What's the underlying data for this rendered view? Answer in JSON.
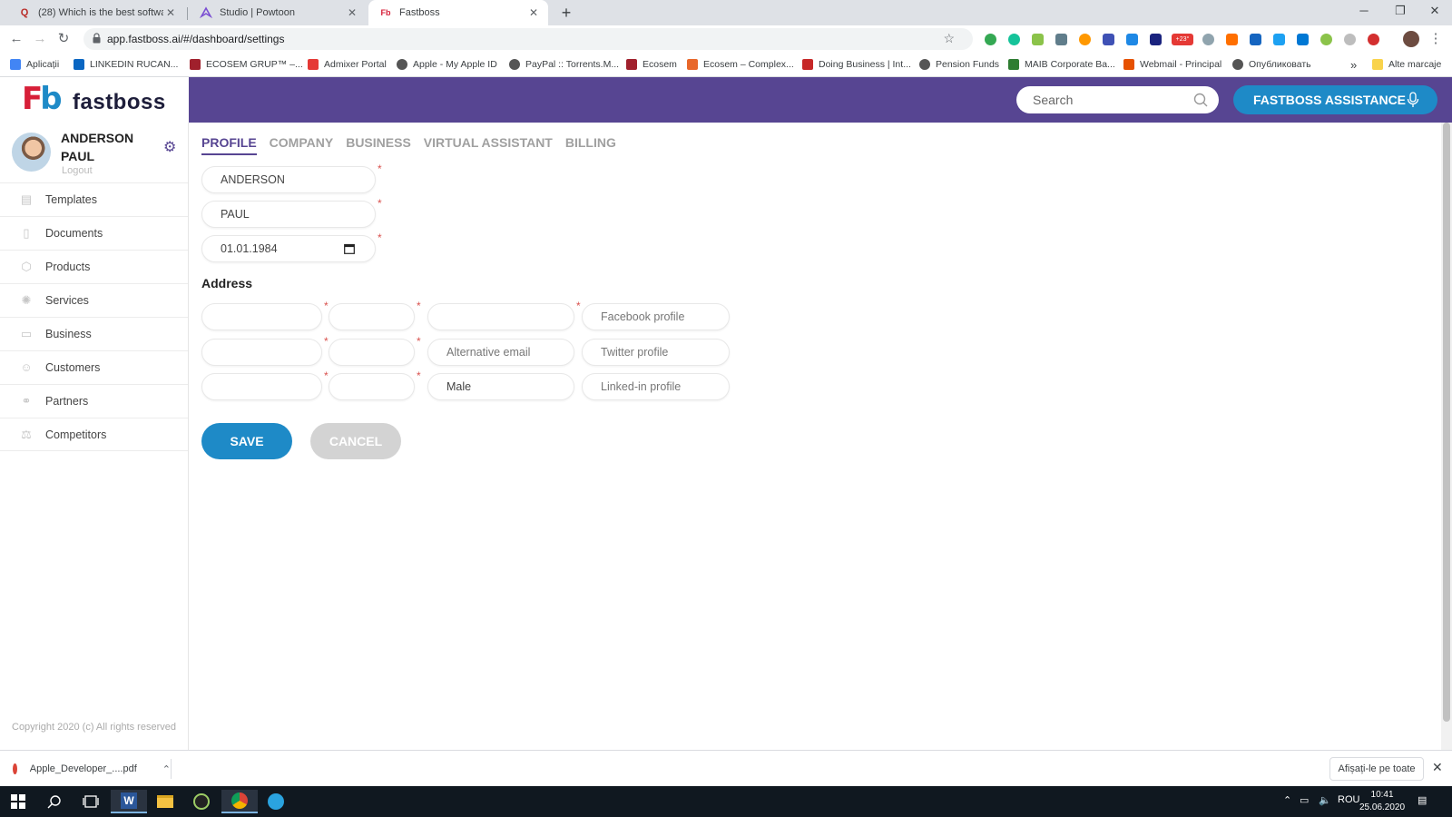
{
  "browser": {
    "tabs": [
      {
        "label": "(28) Which is the best software to",
        "favicon": "Q",
        "favicon_color": "#b92b27",
        "active": false
      },
      {
        "label": "Studio | Powtoon",
        "favicon": "powtoon-icon",
        "favicon_color": "#7b4fd3",
        "active": false
      },
      {
        "label": "Fastboss",
        "favicon": "fastboss-icon",
        "favicon_color": "#d71f38",
        "active": true
      }
    ],
    "url": "app.fastboss.ai/#/dashboard/settings",
    "bookmarks": [
      {
        "label": "Aplicații",
        "color": "#4285f4"
      },
      {
        "label": "LINKEDIN RUCAN...",
        "color": "#0a66c2"
      },
      {
        "label": "ECOSEM GRUP™ –...",
        "color": "#a0202c"
      },
      {
        "label": "Admixer Portal",
        "color": "#e53935"
      },
      {
        "label": "Apple - My Apple ID",
        "color": "#555555"
      },
      {
        "label": "PayPal :: Torrents.M...",
        "color": "#555555"
      },
      {
        "label": "Ecosem",
        "color": "#a0202c"
      },
      {
        "label": "Ecosem – Complex...",
        "color": "#e8672a"
      },
      {
        "label": "Doing Business | Int...",
        "color": "#c62828"
      },
      {
        "label": "Pension Funds",
        "color": "#555555"
      },
      {
        "label": "MAIB Corporate Ba...",
        "color": "#2e7d32"
      },
      {
        "label": "Webmail - Principal",
        "color": "#e65100"
      },
      {
        "label": "Опубликовать",
        "color": "#555555"
      }
    ],
    "bookmarks_more": "»",
    "other_bookmarks": "Alte marcaje",
    "extension_badge": "+23°"
  },
  "app": {
    "logo_mark": "Fb",
    "logo_word": "fastboss",
    "search_placeholder": "Search",
    "assistant_label": "FASTBOSS ASSISTANCE",
    "user": {
      "name": "ANDERSON PAUL",
      "logout": "Logout"
    },
    "nav": [
      {
        "label": "Templates",
        "icon": "table-icon"
      },
      {
        "label": "Documents",
        "icon": "document-icon"
      },
      {
        "label": "Products",
        "icon": "box-icon"
      },
      {
        "label": "Services",
        "icon": "services-icon"
      },
      {
        "label": "Business",
        "icon": "briefcase-icon"
      },
      {
        "label": "Customers",
        "icon": "user-icon"
      },
      {
        "label": "Partners",
        "icon": "handshake-icon"
      },
      {
        "label": "Competitors",
        "icon": "competitors-icon"
      }
    ],
    "copyright": "Copyright 2020 (c) All rights reserved",
    "tabs": [
      "PROFILE",
      "COMPANY",
      "BUSINESS",
      "VIRTUAL ASSISTANT",
      "BILLING"
    ],
    "active_tab": "PROFILE",
    "profile": {
      "first_name": "ANDERSON",
      "last_name": "PAUL",
      "birth_date": "01.01.1984"
    },
    "address_heading": "Address",
    "address": {
      "row1": {
        "c1": "",
        "c2": "",
        "c3": "",
        "c4_placeholder": "Facebook profile"
      },
      "row2": {
        "c1": "",
        "c2": "",
        "c3_placeholder": "Alternative email",
        "c4_placeholder": "Twitter profile"
      },
      "row3": {
        "c1": "",
        "c2": "",
        "c3_value": "Male",
        "c4_placeholder": "Linked-in profile"
      }
    },
    "required_marker": "*",
    "save_label": "SAVE",
    "cancel_label": "CANCEL",
    "colors": {
      "header": "#574592",
      "accent": "#1e8ac7",
      "required": "#d9534f"
    }
  },
  "download_shelf": {
    "file": "Apple_Developer_....pdf",
    "show_all": "Afișați-le pe toate"
  },
  "taskbar": {
    "language": "ROU",
    "time": "10:41",
    "date": "25.06.2020"
  }
}
